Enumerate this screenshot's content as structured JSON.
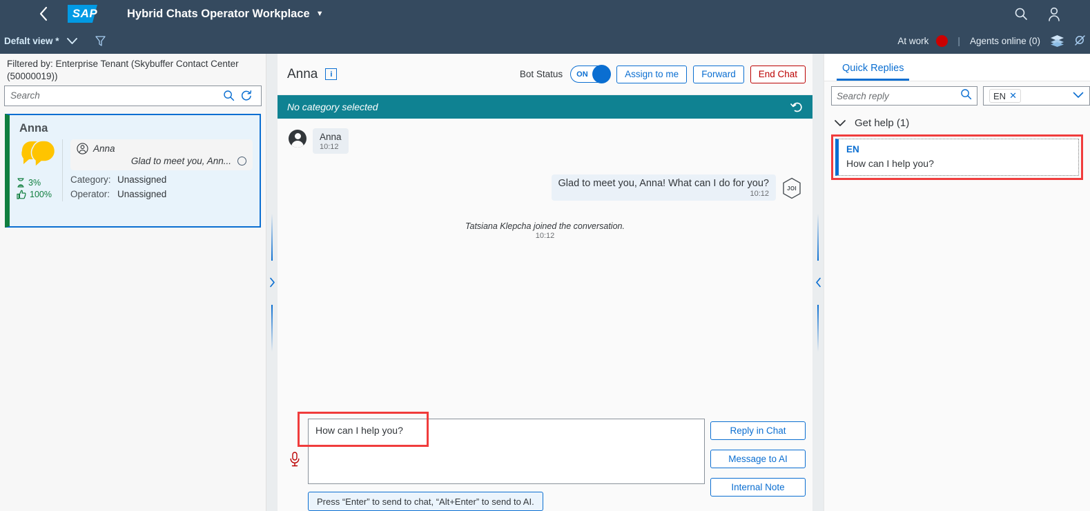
{
  "shellbar": {
    "back_label": "Back",
    "logo_text": "SAP",
    "title": "Hybrid Chats Operator Workplace",
    "title_caret": "▼",
    "search_icon": "search-icon",
    "user_icon": "user-icon"
  },
  "subbar": {
    "view_label": "Defalt view *",
    "view_caret": "⌄",
    "filter_icon": "filter-funnel-icon",
    "status_label": "At work",
    "separator": "|",
    "agents_label": "Agents online (0)",
    "layers_icon": "layers-icon",
    "edit_icon": "edit-pin-icon",
    "status_color": "#cc0000"
  },
  "sidebar": {
    "filtered_by": "Filtered by: Enterprise Tenant (Skybuffer Contact Center (50000019))",
    "search_placeholder": "Search",
    "search_value": "",
    "refresh_icon": "refresh-icon",
    "card": {
      "title": "Anna",
      "avatar_icon": "chat-bubbles-icon",
      "wait_icon": "hourglass-icon",
      "wait_value": "3%",
      "satisfaction_icon": "thumbs-up-icon",
      "satisfaction_value": "100%",
      "preview_author_icon": "person-circle-icon",
      "preview_author": "Anna",
      "preview_message": "Glad to meet you, Ann...",
      "unread_indicator": "empty-circle-icon",
      "category_label": "Category:",
      "category_value": "Unassigned",
      "operator_label": "Operator:",
      "operator_value": "Unassigned",
      "accent_color": "#107e3e",
      "selected_border": "#0a6ed1"
    }
  },
  "splitters": {
    "left_chevron": "›",
    "right_chevron": "‹"
  },
  "chat": {
    "contact_name": "Anna",
    "info_icon": "info-icon",
    "info_glyph": "i",
    "bot_status_label": "Bot Status",
    "bot_status_value": "ON",
    "assign_label": "Assign to me",
    "forward_label": "Forward",
    "end_chat_label": "End Chat",
    "category_text": "No category selected",
    "category_undo_icon": "undo-icon",
    "category_color": "#0f8292",
    "messages": [
      {
        "kind": "incoming",
        "avatar_icon": "person-avatar-icon",
        "author": "Anna",
        "text": "",
        "time": "10:12"
      },
      {
        "kind": "outgoing",
        "avatar_icon": "bot-hexagon-icon",
        "avatar_label": "JOI",
        "author": "",
        "text": "Glad to meet you, Anna! What can I do for you?",
        "time": "10:12"
      },
      {
        "kind": "system",
        "text": "Tatsiana Klepcha joined the conversation.",
        "time": "10:12"
      }
    ],
    "composer": {
      "mic_icon": "microphone-icon",
      "value": "How can I help you?",
      "placeholder": "",
      "hint": "Press “Enter” to send to chat, “Alt+Enter” to send to AI.",
      "buttons": [
        {
          "label": "Reply in Chat"
        },
        {
          "label": "Message to AI"
        },
        {
          "label": "Internal Note"
        }
      ],
      "highlight_color": "#f03c3c"
    }
  },
  "right_panel": {
    "tab_label": "Quick Replies",
    "search_placeholder": "Search reply",
    "search_value": "",
    "search_icon": "search-icon",
    "language_token": "EN",
    "language_remove": "✕",
    "language_caret": "⌄",
    "group": {
      "expand_icon": "chevron-down-icon",
      "label": "Get help (1)"
    },
    "reply": {
      "language": "EN",
      "text": "How can I help you?",
      "highlight_color": "#f03c3c",
      "accent_color": "#0a6ed1"
    }
  }
}
